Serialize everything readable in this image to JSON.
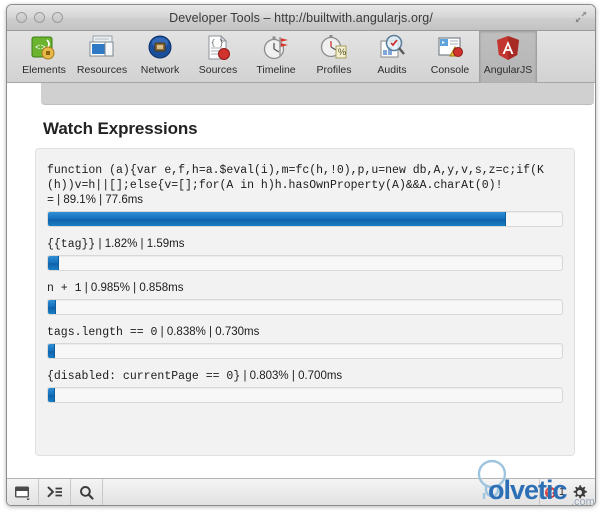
{
  "window": {
    "title": "Developer Tools – http://builtwith.angularjs.org/",
    "traffic_lights": [
      "close",
      "minimize",
      "zoom"
    ],
    "maximize_icon": "maximize-icon"
  },
  "toolbar": {
    "items": [
      {
        "label": "Elements",
        "icon": "elements-icon",
        "selected": false
      },
      {
        "label": "Resources",
        "icon": "resources-icon",
        "selected": false
      },
      {
        "label": "Network",
        "icon": "network-icon",
        "selected": false
      },
      {
        "label": "Sources",
        "icon": "sources-icon",
        "selected": false
      },
      {
        "label": "Timeline",
        "icon": "timeline-icon",
        "selected": false
      },
      {
        "label": "Profiles",
        "icon": "profiles-icon",
        "selected": false
      },
      {
        "label": "Audits",
        "icon": "audits-icon",
        "selected": false
      },
      {
        "label": "Console",
        "icon": "console-icon",
        "selected": false
      },
      {
        "label": "AngularJS",
        "icon": "angularjs-icon",
        "selected": true
      }
    ]
  },
  "main": {
    "section_title": "Watch Expressions",
    "watches": [
      {
        "expression": "function (a){var e,f,h=a.$eval(i),m=fc(h,!0),p,u=new db,A,y,v,s,z=c;if(K(h))v=h||[];else{v=[];for(A in h)h.hasOwnProperty(A)&&A.charAt(0)!=",
        "percent_label": "89.1%",
        "time_label": "77.6ms",
        "percent_value": 89.1,
        "bar_fill_pct": 89.1
      },
      {
        "expression": "{{tag}}",
        "percent_label": "1.82%",
        "time_label": "1.59ms",
        "percent_value": 1.82,
        "bar_fill_pct": 2.2
      },
      {
        "expression": "n + 1",
        "percent_label": "0.985%",
        "time_label": "0.858ms",
        "percent_value": 0.985,
        "bar_fill_pct": 1.6
      },
      {
        "expression": "tags.length == 0",
        "percent_label": "0.838%",
        "time_label": "0.730ms",
        "percent_value": 0.838,
        "bar_fill_pct": 1.4
      },
      {
        "expression": "{disabled: currentPage == 0}",
        "percent_label": "0.803%",
        "time_label": "0.700ms",
        "percent_value": 0.803,
        "bar_fill_pct": 1.3
      }
    ],
    "separator": "|"
  },
  "statusbar": {
    "buttons": [
      {
        "name": "dock-console-button",
        "icon": "dock-window-icon"
      },
      {
        "name": "show-console-button",
        "icon": "console-prompt-icon"
      },
      {
        "name": "search-button",
        "icon": "search-icon"
      }
    ],
    "error_count": "1",
    "error_icon": "error-badge-icon",
    "settings_icon": "gear-icon"
  },
  "watermark": {
    "text": "olvetic",
    "suffix": ".com",
    "mark_color": "#2d6fb5"
  },
  "colors": {
    "bar_fill": "#1772bd",
    "error_red": "#c02020",
    "angular_red": "#b52e31",
    "watermark_blue": "#2d6fb5"
  }
}
